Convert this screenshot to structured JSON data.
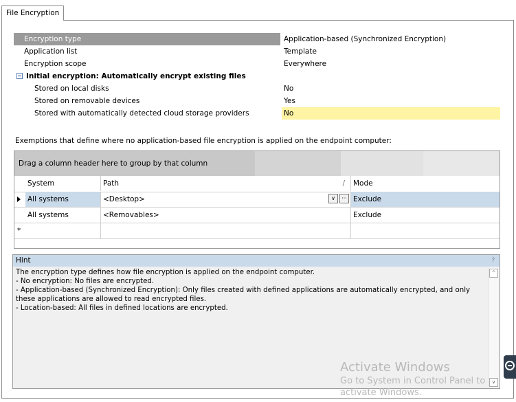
{
  "tab": {
    "label": "File Encryption"
  },
  "properties": [
    {
      "name": "Encryption type",
      "value": "Application-based (Synchronized Encryption)",
      "level": 1,
      "selected": true
    },
    {
      "name": "Application list",
      "value": "Template",
      "level": 1
    },
    {
      "name": "Encryption scope",
      "value": "Everywhere",
      "level": 1
    },
    {
      "name": "Initial encryption: Automatically encrypt existing files",
      "value": "",
      "category": true
    },
    {
      "name": "Stored on local disks",
      "value": "No",
      "level": 2
    },
    {
      "name": "Stored on removable devices",
      "value": "Yes",
      "level": 2
    },
    {
      "name": "Stored with automatically detected cloud storage providers",
      "value": "No",
      "level": 2,
      "highlight": true
    }
  ],
  "exemptions_label": "Exemptions that define where no application-based file encryption is applied on the endpoint computer:",
  "grid": {
    "group_hint": "Drag a column header here to group by that column",
    "columns": {
      "system": "System",
      "path": "Path",
      "mode": "Mode"
    },
    "sort_mark": "/",
    "rows": [
      {
        "system": "All systems",
        "path": "<Desktop>",
        "mode": "Exclude"
      },
      {
        "system": "All systems",
        "path": "<Removables>",
        "mode": "Exclude"
      }
    ],
    "new_row_marker": "*",
    "ellipsis": "···",
    "dropdown_glyph": "∨"
  },
  "hint": {
    "title": "Hint",
    "pin_glyph": "ᚹ",
    "lines": [
      "The encryption type defines how file encryption is applied on the endpoint computer.",
      "- No encryption: No files are encrypted.",
      "- Application-based (Synchronized Encryption): Only files created with defined applications are automatically encrypted, and only these applications are allowed to read encrypted files.",
      "- Location-based: All files in defined locations are encrypted."
    ],
    "scroll_up": "^",
    "scroll_down": "∨"
  },
  "watermark": {
    "line1": "Activate Windows",
    "line2": "Go to System in Control Panel to",
    "line3": "activate Windows."
  }
}
